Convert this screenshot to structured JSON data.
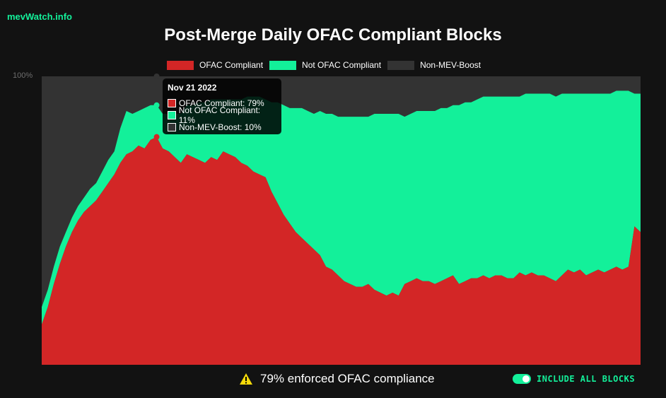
{
  "brand": "mevWatch.info",
  "colors": {
    "ofac": "#d32626",
    "not_ofac": "#13f09a",
    "non_mev": "#333333",
    "background": "#121212",
    "accent": "#13f09a",
    "warning": "#f5d90a"
  },
  "tooltip": {
    "date": "Nov 21 2022",
    "rows": [
      {
        "label": "OFAC Compliant: 79%",
        "color": "#d32626"
      },
      {
        "label": "Not OFAC Compliant: 11%",
        "color": "#13f09a"
      },
      {
        "label": "Non-MEV-Boost: 10%",
        "color": "#333333"
      }
    ]
  },
  "footer": {
    "warning_icon": "warning-icon",
    "compliance_text": "79% enforced OFAC compliance",
    "toggle_label": "INCLUDE ALL BLOCKS",
    "toggle_on": true
  },
  "chart_data": {
    "type": "area",
    "stacked": true,
    "title": "Post-Merge Daily OFAC Compliant Blocks",
    "xlabel": "",
    "ylabel": "",
    "ylim": [
      0,
      100
    ],
    "yticks": [
      "100%"
    ],
    "grid": false,
    "legend_position": "top-center",
    "n_days": 100,
    "highlight_index": 19,
    "legend": [
      "OFAC Compliant",
      "Not OFAC Compliant",
      "Non-MEV-Boost"
    ],
    "ofac": [
      14,
      20,
      28,
      35,
      41,
      46,
      50,
      53,
      55,
      57,
      60,
      63,
      66,
      70,
      73,
      74,
      76,
      75,
      78,
      79,
      75,
      74,
      72,
      70,
      73,
      72,
      71,
      70,
      72,
      71,
      74,
      73,
      72,
      70,
      69,
      67,
      66,
      65,
      60,
      56,
      52,
      49,
      46,
      44,
      42,
      40,
      38,
      34,
      33,
      31,
      29,
      28,
      27,
      27,
      28,
      26,
      25,
      24,
      25,
      24,
      28,
      29,
      30,
      29,
      29,
      28,
      29,
      30,
      31,
      28,
      29,
      30,
      30,
      31,
      30,
      31,
      31,
      30,
      30,
      32,
      31,
      32,
      31,
      31,
      30,
      29,
      31,
      33,
      32,
      33,
      31,
      32,
      33,
      32,
      33,
      34,
      33,
      34,
      48,
      46
    ],
    "not_ofac": [
      6,
      6,
      6,
      6,
      5,
      5,
      5,
      5,
      6,
      6,
      7,
      8,
      8,
      12,
      15,
      13,
      12,
      14,
      12,
      11,
      12,
      13,
      15,
      17,
      17,
      18,
      20,
      21,
      20,
      21,
      18,
      19,
      20,
      22,
      24,
      26,
      27,
      27,
      31,
      35,
      38,
      40,
      43,
      45,
      46,
      47,
      50,
      53,
      54,
      55,
      57,
      58,
      59,
      59,
      58,
      61,
      62,
      63,
      62,
      63,
      58,
      58,
      58,
      59,
      59,
      60,
      60,
      59,
      59,
      62,
      62,
      61,
      62,
      62,
      63,
      62,
      62,
      63,
      63,
      61,
      63,
      62,
      63,
      63,
      64,
      64,
      63,
      61,
      62,
      61,
      63,
      62,
      61,
      62,
      61,
      61,
      62,
      61,
      46,
      48
    ]
  }
}
